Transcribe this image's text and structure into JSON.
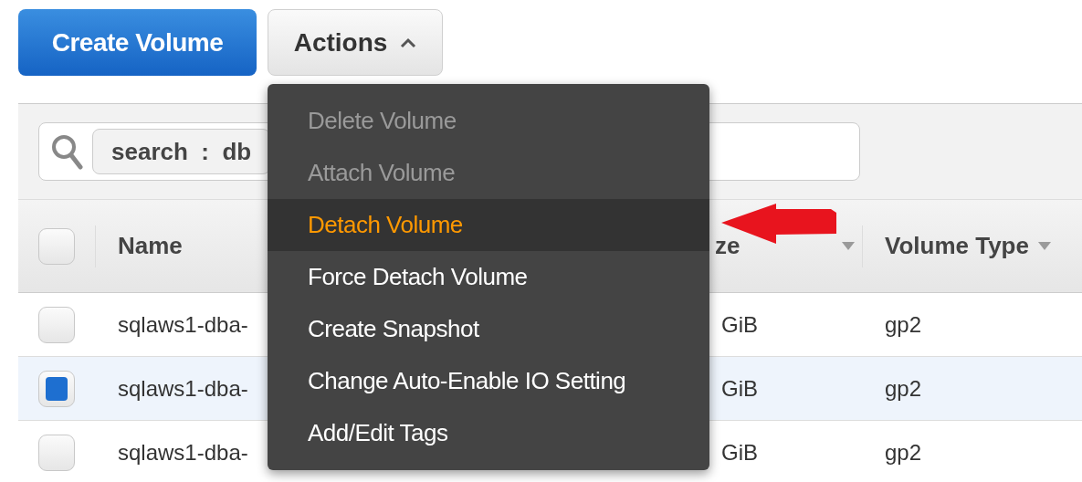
{
  "toolbar": {
    "create_button": "Create Volume",
    "actions_button": {
      "label": "Actions",
      "expanded": true
    }
  },
  "search": {
    "token": "search  :  db"
  },
  "table": {
    "all_checked": false,
    "columns": [
      {
        "label": "Name",
        "sortable": false
      },
      {
        "label": "ze",
        "sortable": true
      },
      {
        "label": "Volume Type",
        "sortable": true
      }
    ],
    "rows": [
      {
        "selected": false,
        "name": "sqlaws1-dba-",
        "size": "GiB",
        "type": "gp2"
      },
      {
        "selected": true,
        "name": "sqlaws1-dba-",
        "size": "GiB",
        "type": "gp2"
      },
      {
        "selected": false,
        "name": "sqlaws1-dba-",
        "size": "GiB",
        "type": "gp2"
      }
    ]
  },
  "menu": {
    "items": [
      {
        "label": "Delete Volume",
        "disabled": true,
        "highlighted": false
      },
      {
        "label": "Attach Volume",
        "disabled": true,
        "highlighted": false
      },
      {
        "label": "Detach Volume",
        "disabled": false,
        "highlighted": true
      },
      {
        "label": "Force Detach Volume",
        "disabled": false,
        "highlighted": false
      },
      {
        "label": "Create Snapshot",
        "disabled": false,
        "highlighted": false
      },
      {
        "label": "Change Auto-Enable IO Setting",
        "disabled": false,
        "highlighted": false
      },
      {
        "label": "Add/Edit Tags",
        "disabled": false,
        "highlighted": false
      }
    ]
  }
}
